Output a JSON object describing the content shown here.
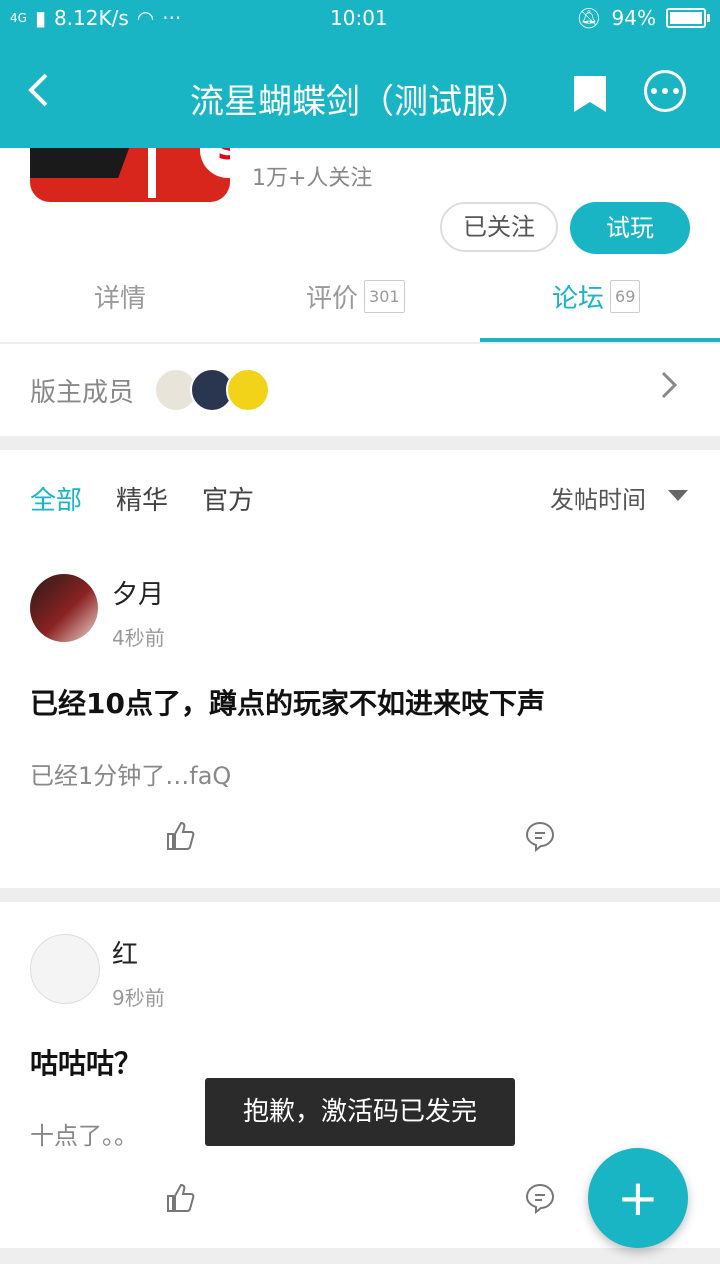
{
  "status_bar": {
    "network": "4G",
    "speed": "8.12K/s",
    "more": "···",
    "time": "10:01",
    "battery": "94%"
  },
  "header": {
    "back": "<",
    "title": "流星蝴蝶剑（测试服）"
  },
  "game": {
    "logo_badge": "S",
    "followers": "1万+人关注",
    "followed_label": "已关注",
    "try_label": "试玩"
  },
  "tabs": [
    {
      "label": "详情",
      "count": ""
    },
    {
      "label": "评价",
      "count": "301"
    },
    {
      "label": "论坛",
      "count": "69"
    }
  ],
  "moderators": {
    "label": "版主成员"
  },
  "filters": {
    "all": "全部",
    "featured": "精华",
    "official": "官方",
    "sort": "发帖时间"
  },
  "posts": [
    {
      "author": "夕月",
      "time": "4秒前",
      "title": "已经10点了，蹲点的玩家不如进来吱下声",
      "excerpt": "已经1分钟了…faQ"
    },
    {
      "author": "红",
      "time": "9秒前",
      "title": "咕咕咕？",
      "excerpt": "十点了。。"
    }
  ],
  "toast": "抱歉，激活码已发完",
  "fab": "+",
  "colors": {
    "accent": "#1ab5c4"
  }
}
